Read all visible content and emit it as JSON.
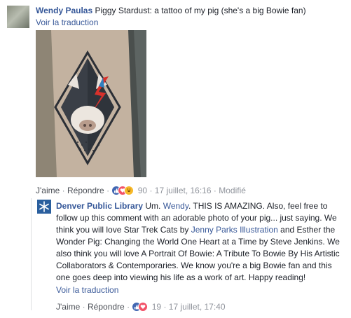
{
  "comment": {
    "author": "Wendy Paulas",
    "text": "Piggy Stardust: a tattoo of my pig (she's a big Bowie fan)",
    "translate": "Voir la traduction",
    "actions": {
      "like": "J'aime",
      "reply": "Répondre",
      "reaction_count": "90",
      "date": "17 juillet, 16:16",
      "edited": "Modifié"
    }
  },
  "reply": {
    "author": "Denver Public Library",
    "text_1": " Um. ",
    "mention_wendy": "Wendy",
    "text_2": ". THIS IS AMAZING. Also, feel free to follow up this comment with an adorable photo of your pig... just saying. We think you will love Star Trek Cats by ",
    "mention_jenny": "Jenny Parks Illustration",
    "text_3": " and Esther the Wonder Pig: Changing the World One Heart at a Time by Steve Jenkins. We also think you will love A Portrait Of Bowie: A Tribute To Bowie By His Artistic Collaborators & Contemporaries. We know you're a big Bowie fan and this one goes deep into viewing his life as a work of art. Happy reading!",
    "translate": "Voir la traduction",
    "actions": {
      "like": "J'aime",
      "reply": "Répondre",
      "reaction_count": "19",
      "date": "17 juillet, 17:40"
    }
  },
  "colors": {
    "link": "#365899",
    "meta": "#90949c",
    "like": "#4267b2",
    "love": "#f25268",
    "haha": "#f7b928"
  }
}
